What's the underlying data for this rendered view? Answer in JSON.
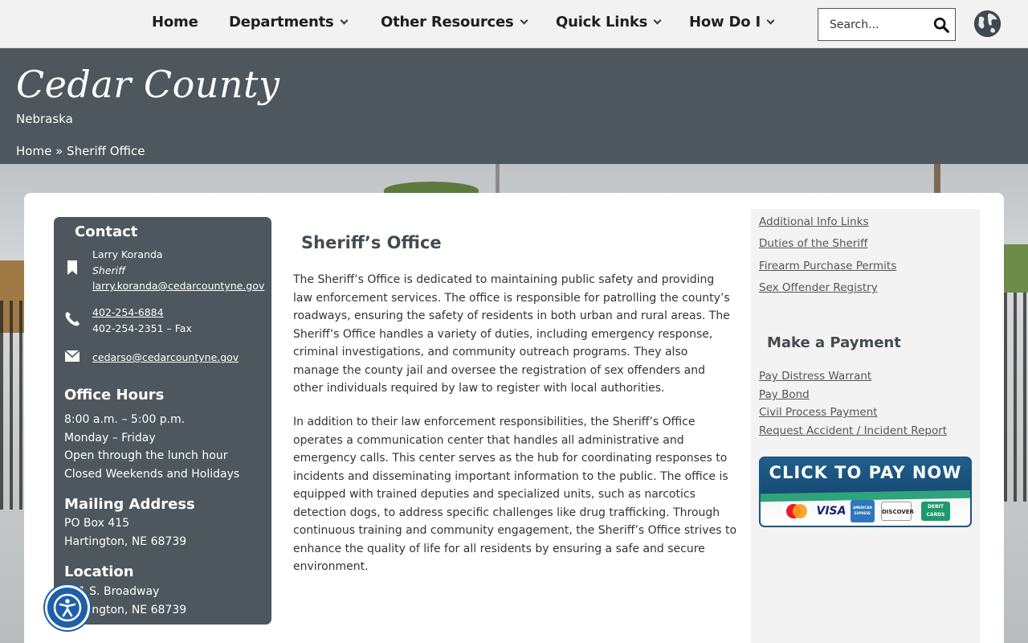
{
  "nav": {
    "items": [
      {
        "label": "Home",
        "has_dropdown": false
      },
      {
        "label": "Departments",
        "has_dropdown": true
      },
      {
        "label": "Other Resources",
        "has_dropdown": true
      },
      {
        "label": "Quick Links",
        "has_dropdown": true
      },
      {
        "label": "How Do I",
        "has_dropdown": true
      }
    ],
    "search_placeholder": "Search...",
    "search_icon": "search-icon",
    "language_icon": "globe-icon"
  },
  "header": {
    "title": "Cedar County",
    "subtitle": "Nebraska",
    "breadcrumb": {
      "home": "Home",
      "separator": "»",
      "current": "Sheriff Office"
    }
  },
  "contact": {
    "title": "Contact",
    "name": "Larry Koranda",
    "role": "Sheriff",
    "email": "larry.koranda@cedarcountyne.gov",
    "phone": "402-254-6884",
    "fax": "402-254-2351 – Fax",
    "office_email": "cedarso@cedarcountyne.gov",
    "hours_title": "Office Hours",
    "hours": [
      "8:00 a.m. – 5:00 p.m.",
      "Monday – Friday",
      "Open through the lunch hour",
      "Closed Weekends and Holidays"
    ],
    "mailing_title": "Mailing Address",
    "mailing": [
      "PO Box 415",
      "Hartington, NE 68739"
    ],
    "location_title": "Location",
    "location": [
      "101 S. Broadway",
      "Hartington, NE 68739"
    ]
  },
  "article": {
    "title": "Sheriff’s Office",
    "p1": "The Sheriff’s Office is dedicated to maintaining public safety and providing law enforcement services. The office is responsible for patrolling the county’s roadways, ensuring the safety of residents in both urban and rural areas. The Sheriff’s Office handles a variety of duties, including emergency response, criminal investigations, and community outreach programs. They also manage the county jail and oversee the registration of sex offenders and other individuals required by law to register with local authorities.",
    "p2": "In addition to their law enforcement responsibilities, the Sheriff’s Office operates a communication center that handles all administrative and emergency calls. This center serves as the hub for coordinating responses to incidents and disseminating important information to the public. The office is equipped with trained deputies and specialized units, such as narcotics detection dogs, to address specific challenges like drug trafficking. Through continuous training and community engagement, the Sheriff’s Office strives to enhance the quality of life for all residents by ensuring a safe and secure environment."
  },
  "sidebar": {
    "info_links": [
      "Additional Info Links",
      "Duties of the Sheriff",
      "Firearm Purchase Permits",
      "Sex Offender Registry"
    ],
    "payment_title": "Make a Payment",
    "payment_links": [
      "Pay Distress Warrant",
      "Pay Bond",
      "Civil Process Payment",
      "Request Accident / Incident Report"
    ],
    "pay_banner": {
      "text": "CLICK TO PAY NOW",
      "cards": [
        "MasterCard",
        "VISA",
        "AMERICAN EXPRESS",
        "DISCOVER",
        "DEBIT CARDS"
      ]
    }
  },
  "colors": {
    "header_bg": "#4d575d",
    "nav_bg": "#f2f2f2",
    "accessibility_blue": "#1f5fa8",
    "pay_blue": "#1f5e8c"
  },
  "accessibility_icon": "accessibility-icon"
}
